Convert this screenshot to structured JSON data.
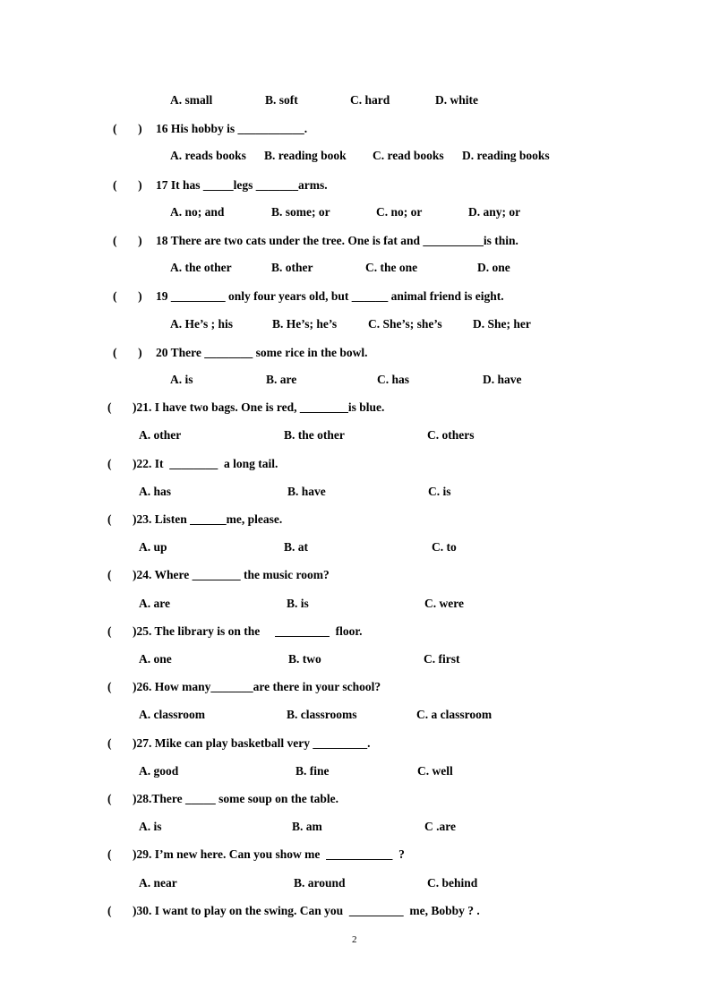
{
  "page_number": "2",
  "questions": [
    {
      "id": "15",
      "stem": null,
      "options": [
        "A. small",
        "B. soft",
        "C. hard",
        "D. white"
      ]
    },
    {
      "id": "16",
      "paren": "(        )",
      "stem": "16 His hobby is ___________.",
      "options": [
        "A. reads books",
        "B. reading book",
        "C. read books",
        "D. reading books"
      ]
    },
    {
      "id": "17",
      "paren": "(        )",
      "stem": "17 It has _____legs _______arms.",
      "options": [
        "A. no; and",
        "B. some; or",
        "C. no; or",
        "D. any; or"
      ]
    },
    {
      "id": "18",
      "paren": "(        )",
      "stem": "18 There are two cats under the tree. One is fat and __________is thin.",
      "options": [
        "A. the other",
        "B. other",
        "C. the one",
        "D. one"
      ]
    },
    {
      "id": "19",
      "paren": "(        )",
      "stem": "19 _________ only four years old, but ______ animal friend is eight.",
      "options": [
        "A. He’s ; his",
        "B. He’s; he’s",
        "C. She’s; she’s",
        "D. She; her"
      ]
    },
    {
      "id": "20",
      "paren": "(        )",
      "stem": "20 There ________ some rice in the bowl.",
      "options": [
        "A. is",
        "B. are",
        "C. has",
        "D. have"
      ]
    },
    {
      "id": "21",
      "paren": "(",
      "stem": ")21. I have two bags. One is red, ________is blue.",
      "options": [
        "A. other",
        "B. the other",
        "C. others"
      ]
    },
    {
      "id": "22",
      "paren": "(",
      "stem": ")22. It  ________  a long tail.",
      "options": [
        "A. has",
        "B. have",
        "C. is"
      ]
    },
    {
      "id": "23",
      "paren": "(",
      "stem": ")23. Listen ______me, please.",
      "options": [
        "A. up",
        "B. at",
        "C. to"
      ]
    },
    {
      "id": "24",
      "paren": "(",
      "stem": ")24. Where ________ the music room?",
      "options": [
        "A. are",
        "B. is",
        "C. were"
      ]
    },
    {
      "id": "25",
      "paren": "(",
      "stem": ")25. The library is on the     _________  floor.",
      "options": [
        "A. one",
        "B. two",
        "C. first"
      ]
    },
    {
      "id": "26",
      "paren": "(",
      "stem": ")26. How many_______are there in your school?",
      "options": [
        "A. classroom",
        "B. classrooms",
        "C. a classroom"
      ]
    },
    {
      "id": "27",
      "paren": "(",
      "stem": ")27. Mike can play basketball very _________.",
      "options": [
        "A. good",
        "B. fine",
        "C. well"
      ]
    },
    {
      "id": "28",
      "paren": "(",
      "stem": ")28.There _____ some soup on the table.",
      "options": [
        "A. is",
        "B. am",
        "C .are"
      ]
    },
    {
      "id": "29",
      "paren": "(",
      "stem": ")29. I’m new here. Can you show me  ___________  ?",
      "options": [
        "A. near",
        "B. around",
        "C. behind"
      ]
    },
    {
      "id": "30",
      "paren": "(",
      "stem": ")30. I want to play on the swing. Can you  _________  me, Bobby ? .",
      "options": []
    }
  ]
}
